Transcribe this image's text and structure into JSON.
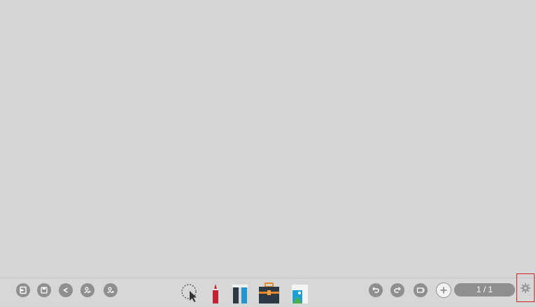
{
  "canvas": {
    "background": "#d5d6d5"
  },
  "toolbar": {
    "left_buttons": [
      {
        "name": "exit-icon"
      },
      {
        "name": "save-icon"
      },
      {
        "name": "share-icon"
      },
      {
        "name": "add-user-icon"
      },
      {
        "name": "user-settings-icon"
      }
    ],
    "tools": [
      {
        "name": "lasso-select-icon"
      },
      {
        "name": "pen-icon"
      },
      {
        "name": "eraser-icon"
      },
      {
        "name": "toolbox-icon"
      },
      {
        "name": "image-icon"
      }
    ],
    "right_buttons": [
      {
        "name": "undo-icon"
      },
      {
        "name": "redo-icon"
      },
      {
        "name": "page-view-icon"
      },
      {
        "name": "add-page-icon"
      }
    ],
    "page_indicator": "1 / 1",
    "settings": {
      "name": "gear-icon",
      "highlight_color": "#d32026"
    }
  }
}
